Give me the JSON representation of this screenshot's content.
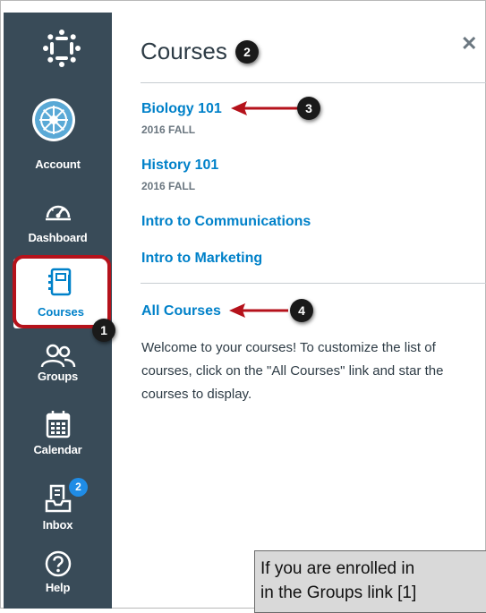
{
  "nav": {
    "items": [
      {
        "label": "Account"
      },
      {
        "label": "Dashboard"
      },
      {
        "label": "Courses"
      },
      {
        "label": "Groups"
      },
      {
        "label": "Calendar"
      },
      {
        "label": "Inbox",
        "badge": "2"
      },
      {
        "label": "Help"
      }
    ]
  },
  "tray": {
    "title": "Courses",
    "courses": [
      {
        "name": "Biology 101",
        "term": "2016 FALL"
      },
      {
        "name": "History 101",
        "term": "2016 FALL"
      },
      {
        "name": "Intro to Communications",
        "term": ""
      },
      {
        "name": "Intro to Marketing",
        "term": ""
      }
    ],
    "all_courses_label": "All Courses",
    "welcome_text": "Welcome to your courses! To customize the list of courses, click on the \"All Courses\" link and star the courses to display."
  },
  "callouts": [
    "1",
    "2",
    "3",
    "4"
  ],
  "caption": {
    "line1": "If you are enrolled in",
    "line2": "in the Groups link [1]"
  },
  "colors": {
    "nav_bg": "#394b58",
    "link": "#0081c9",
    "highlight": "#b5121b",
    "badge": "#1f8ce6"
  }
}
